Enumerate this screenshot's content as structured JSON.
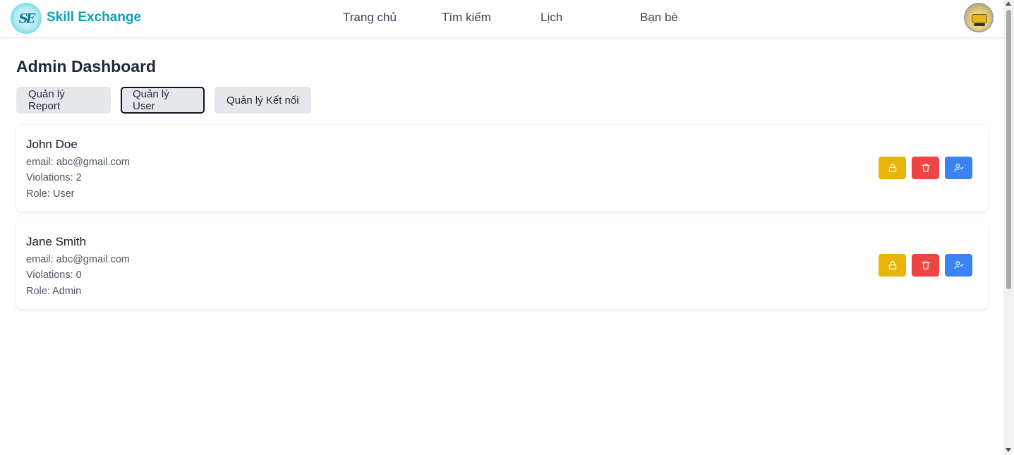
{
  "app": {
    "brand": "Skill Exchange",
    "logo_text": "SE"
  },
  "nav": {
    "items": [
      {
        "label": "Trang chủ"
      },
      {
        "label": "Tìm kiếm"
      },
      {
        "label": "Lịch"
      },
      {
        "label": "Bạn bè"
      }
    ]
  },
  "page": {
    "title": "Admin Dashboard"
  },
  "tabs": [
    {
      "label": "Quản lý Report",
      "active": false
    },
    {
      "label": "Quản lý User",
      "active": true
    },
    {
      "label": "Quản lý Kết nối",
      "active": false
    }
  ],
  "users": [
    {
      "name": "John Doe",
      "email": "email: abc@gmail.com",
      "violations": "Violations: 2",
      "role": "Role: User"
    },
    {
      "name": "Jane Smith",
      "email": "email: abc@gmail.com",
      "violations": "Violations: 0",
      "role": "Role: Admin"
    }
  ],
  "actions": {
    "lock_icon": "lock-icon",
    "delete_icon": "trash-icon",
    "role_icon": "user-check-icon"
  },
  "colors": {
    "brand": "#0aa3b5",
    "lock": "#eab308",
    "delete": "#ef4444",
    "role": "#3b82f6"
  }
}
